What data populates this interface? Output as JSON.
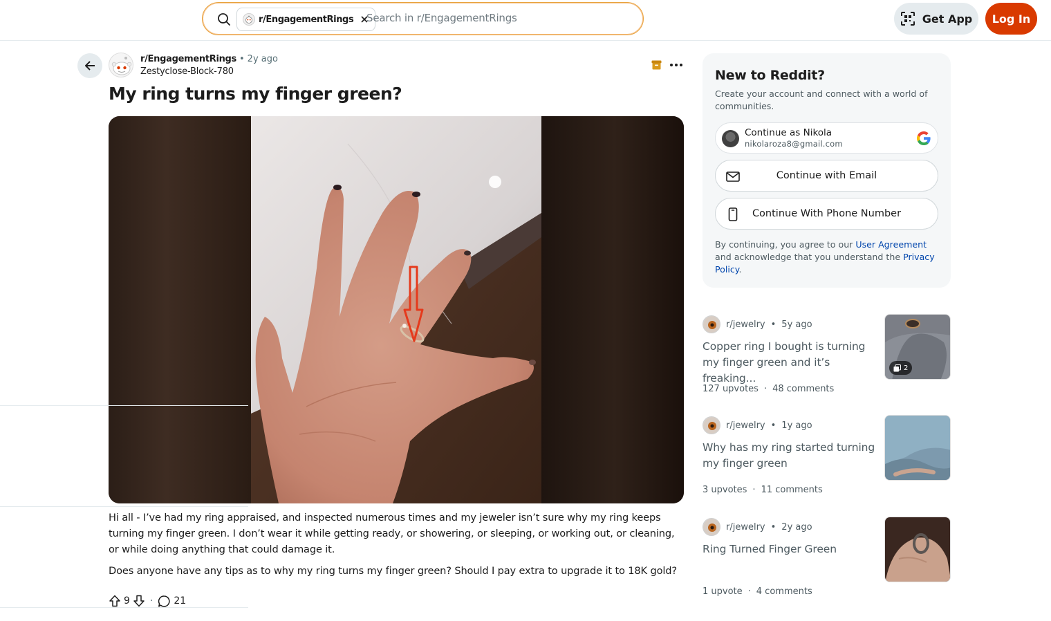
{
  "header": {
    "search_scope": "r/EngagementRings",
    "search_placeholder": "Search in r/EngagementRings",
    "get_app_label": "Get App",
    "login_label": "Log In"
  },
  "post": {
    "subreddit": "r/EngagementRings",
    "time_ago": "2y ago",
    "author": "Zestyclose-Block-780",
    "title": "My ring turns my finger green?",
    "body": [
      "Hi all - I’ve had my ring appraised, and inspected numerous times and my jeweler isn’t sure why my ring keeps turning my finger green. I don’t wear it while getting ready, or showering, or sleeping, or working out, or cleaning, or while doing anything that could damage it.",
      "Does anyone have any tips as to why my ring turns my finger green? Should I pay extra to upgrade it to 18K gold?"
    ],
    "upvotes": "9",
    "comments": "21"
  },
  "signup": {
    "title": "New to Reddit?",
    "subtitle": "Create your account and connect with a world of communities.",
    "google_name": "Continue as Nikola",
    "google_email": "nikolaroza8@gmail.com",
    "email_label": "Continue with Email",
    "phone_label": "Continue With Phone Number",
    "legal_prefix": "By continuing, you agree to our ",
    "legal_link1": "User Agreement",
    "legal_middle": " and acknowledge that you understand the ",
    "legal_link2": "Privacy Policy",
    "legal_suffix": "."
  },
  "related": [
    {
      "subreddit": "r/jewelry",
      "time_ago": "5y ago",
      "title": "Copper ring I bought is turning my finger green and it’s freaking...",
      "upvotes": "127 upvotes",
      "comments": "48 comments",
      "gallery_count": "2"
    },
    {
      "subreddit": "r/jewelry",
      "time_ago": "1y ago",
      "title": "Why has my ring started turning my finger green",
      "upvotes": "3 upvotes",
      "comments": "11 comments"
    },
    {
      "subreddit": "r/jewelry",
      "time_ago": "2y ago",
      "title": "Ring Turned Finger Green",
      "upvotes": "1 upvote",
      "comments": "4 comments"
    }
  ],
  "colors": {
    "brand_orange": "#d93a00",
    "link_blue": "#0045ac",
    "search_border": "#e8a33d",
    "annotation_arrow": "#e53a1c"
  }
}
